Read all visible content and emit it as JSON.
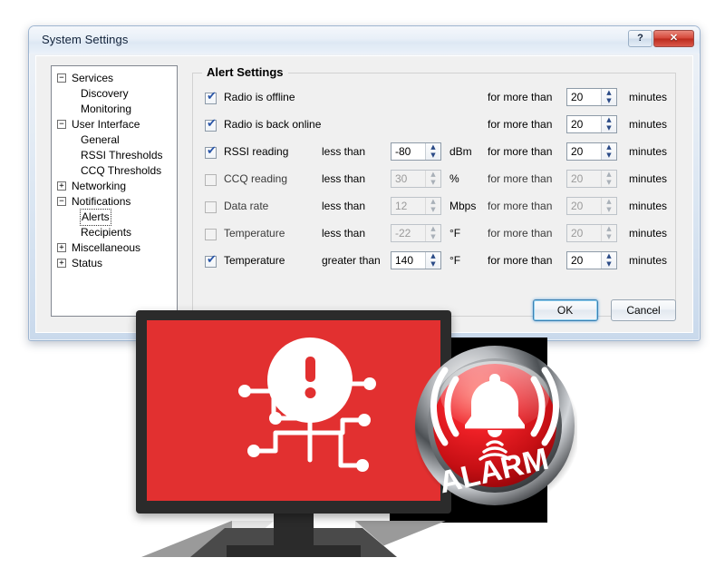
{
  "window": {
    "title": "System Settings",
    "help_button": "?",
    "close_button": "✕"
  },
  "sidebar": {
    "items": [
      {
        "label": "Services",
        "level": 0,
        "toggle": "−",
        "selected": false
      },
      {
        "label": "Discovery",
        "level": 1,
        "toggle": "",
        "selected": false
      },
      {
        "label": "Monitoring",
        "level": 1,
        "toggle": "",
        "selected": false
      },
      {
        "label": "User Interface",
        "level": 0,
        "toggle": "−",
        "selected": false
      },
      {
        "label": "General",
        "level": 1,
        "toggle": "",
        "selected": false
      },
      {
        "label": "RSSI Thresholds",
        "level": 1,
        "toggle": "",
        "selected": false
      },
      {
        "label": "CCQ Thresholds",
        "level": 1,
        "toggle": "",
        "selected": false
      },
      {
        "label": "Networking",
        "level": 0,
        "toggle": "+",
        "selected": false
      },
      {
        "label": "Notifications",
        "level": 0,
        "toggle": "−",
        "selected": false
      },
      {
        "label": "Alerts",
        "level": 1,
        "toggle": "",
        "selected": true
      },
      {
        "label": "Recipients",
        "level": 1,
        "toggle": "",
        "selected": false
      },
      {
        "label": "Miscellaneous",
        "level": 0,
        "toggle": "+",
        "selected": false
      },
      {
        "label": "Status",
        "level": 0,
        "toggle": "+",
        "selected": false
      }
    ]
  },
  "alert_settings": {
    "group_title": "Alert Settings",
    "checked_glyph": "✔",
    "spin_up_glyph": "▲",
    "spin_down_glyph": "▼",
    "rows": [
      {
        "enabled": true,
        "label": "Radio is offline",
        "comparator": "",
        "threshold": "",
        "unit": "",
        "duration_label": "for more than",
        "duration": "20",
        "duration_unit": "minutes"
      },
      {
        "enabled": true,
        "label": "Radio is back online",
        "comparator": "",
        "threshold": "",
        "unit": "",
        "duration_label": "for more than",
        "duration": "20",
        "duration_unit": "minutes"
      },
      {
        "enabled": true,
        "label": "RSSI reading",
        "comparator": "less than",
        "threshold": "-80",
        "unit": "dBm",
        "duration_label": "for more than",
        "duration": "20",
        "duration_unit": "minutes"
      },
      {
        "enabled": false,
        "label": "CCQ reading",
        "comparator": "less than",
        "threshold": "30",
        "unit": "%",
        "duration_label": "for more than",
        "duration": "20",
        "duration_unit": "minutes"
      },
      {
        "enabled": false,
        "label": "Data rate",
        "comparator": "less than",
        "threshold": "12",
        "unit": "Mbps",
        "duration_label": "for more than",
        "duration": "20",
        "duration_unit": "minutes"
      },
      {
        "enabled": false,
        "label": "Temperature",
        "comparator": "less than",
        "threshold": "-22",
        "unit": "°F",
        "duration_label": "for more than",
        "duration": "20",
        "duration_unit": "minutes"
      },
      {
        "enabled": true,
        "label": "Temperature",
        "comparator": "greater than",
        "threshold": "140",
        "unit": "°F",
        "duration_label": "for more than",
        "duration": "20",
        "duration_unit": "minutes"
      }
    ]
  },
  "footer": {
    "ok_label": "OK",
    "cancel_label": "Cancel"
  },
  "graphic": {
    "alarm_text": "ALARM",
    "screen_color": "#e23030",
    "alarm_red": "#e1121a",
    "bezel_color": "#2b2b2b"
  }
}
